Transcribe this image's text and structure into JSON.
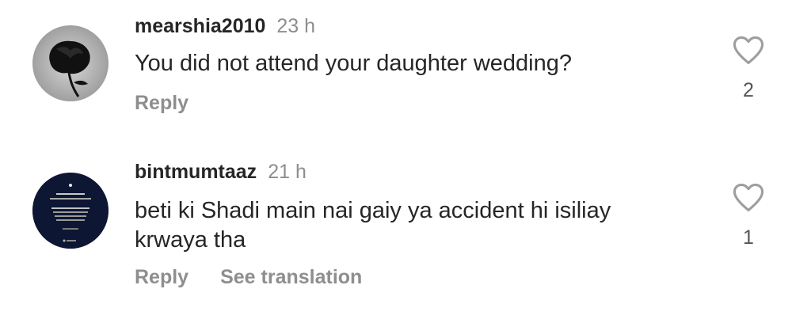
{
  "comments": [
    {
      "username": "mearshia2010",
      "time": "23 h",
      "text": "You did not attend your daughter wedding?",
      "reply_label": "Reply",
      "likes": "2",
      "avatar_icon": "black-rose-avatar"
    },
    {
      "username": "bintmumtaaz",
      "time": "21 h",
      "text": "beti ki Shadi main nai gaiy ya accident hi isiliay krwaya tha",
      "reply_label": "Reply",
      "translation_label": "See translation",
      "likes": "1",
      "avatar_icon": "quote-card-avatar"
    }
  ],
  "colors": {
    "text": "#262626",
    "muted": "#8e8e8e",
    "heart_outline": "#9e9e9e"
  }
}
